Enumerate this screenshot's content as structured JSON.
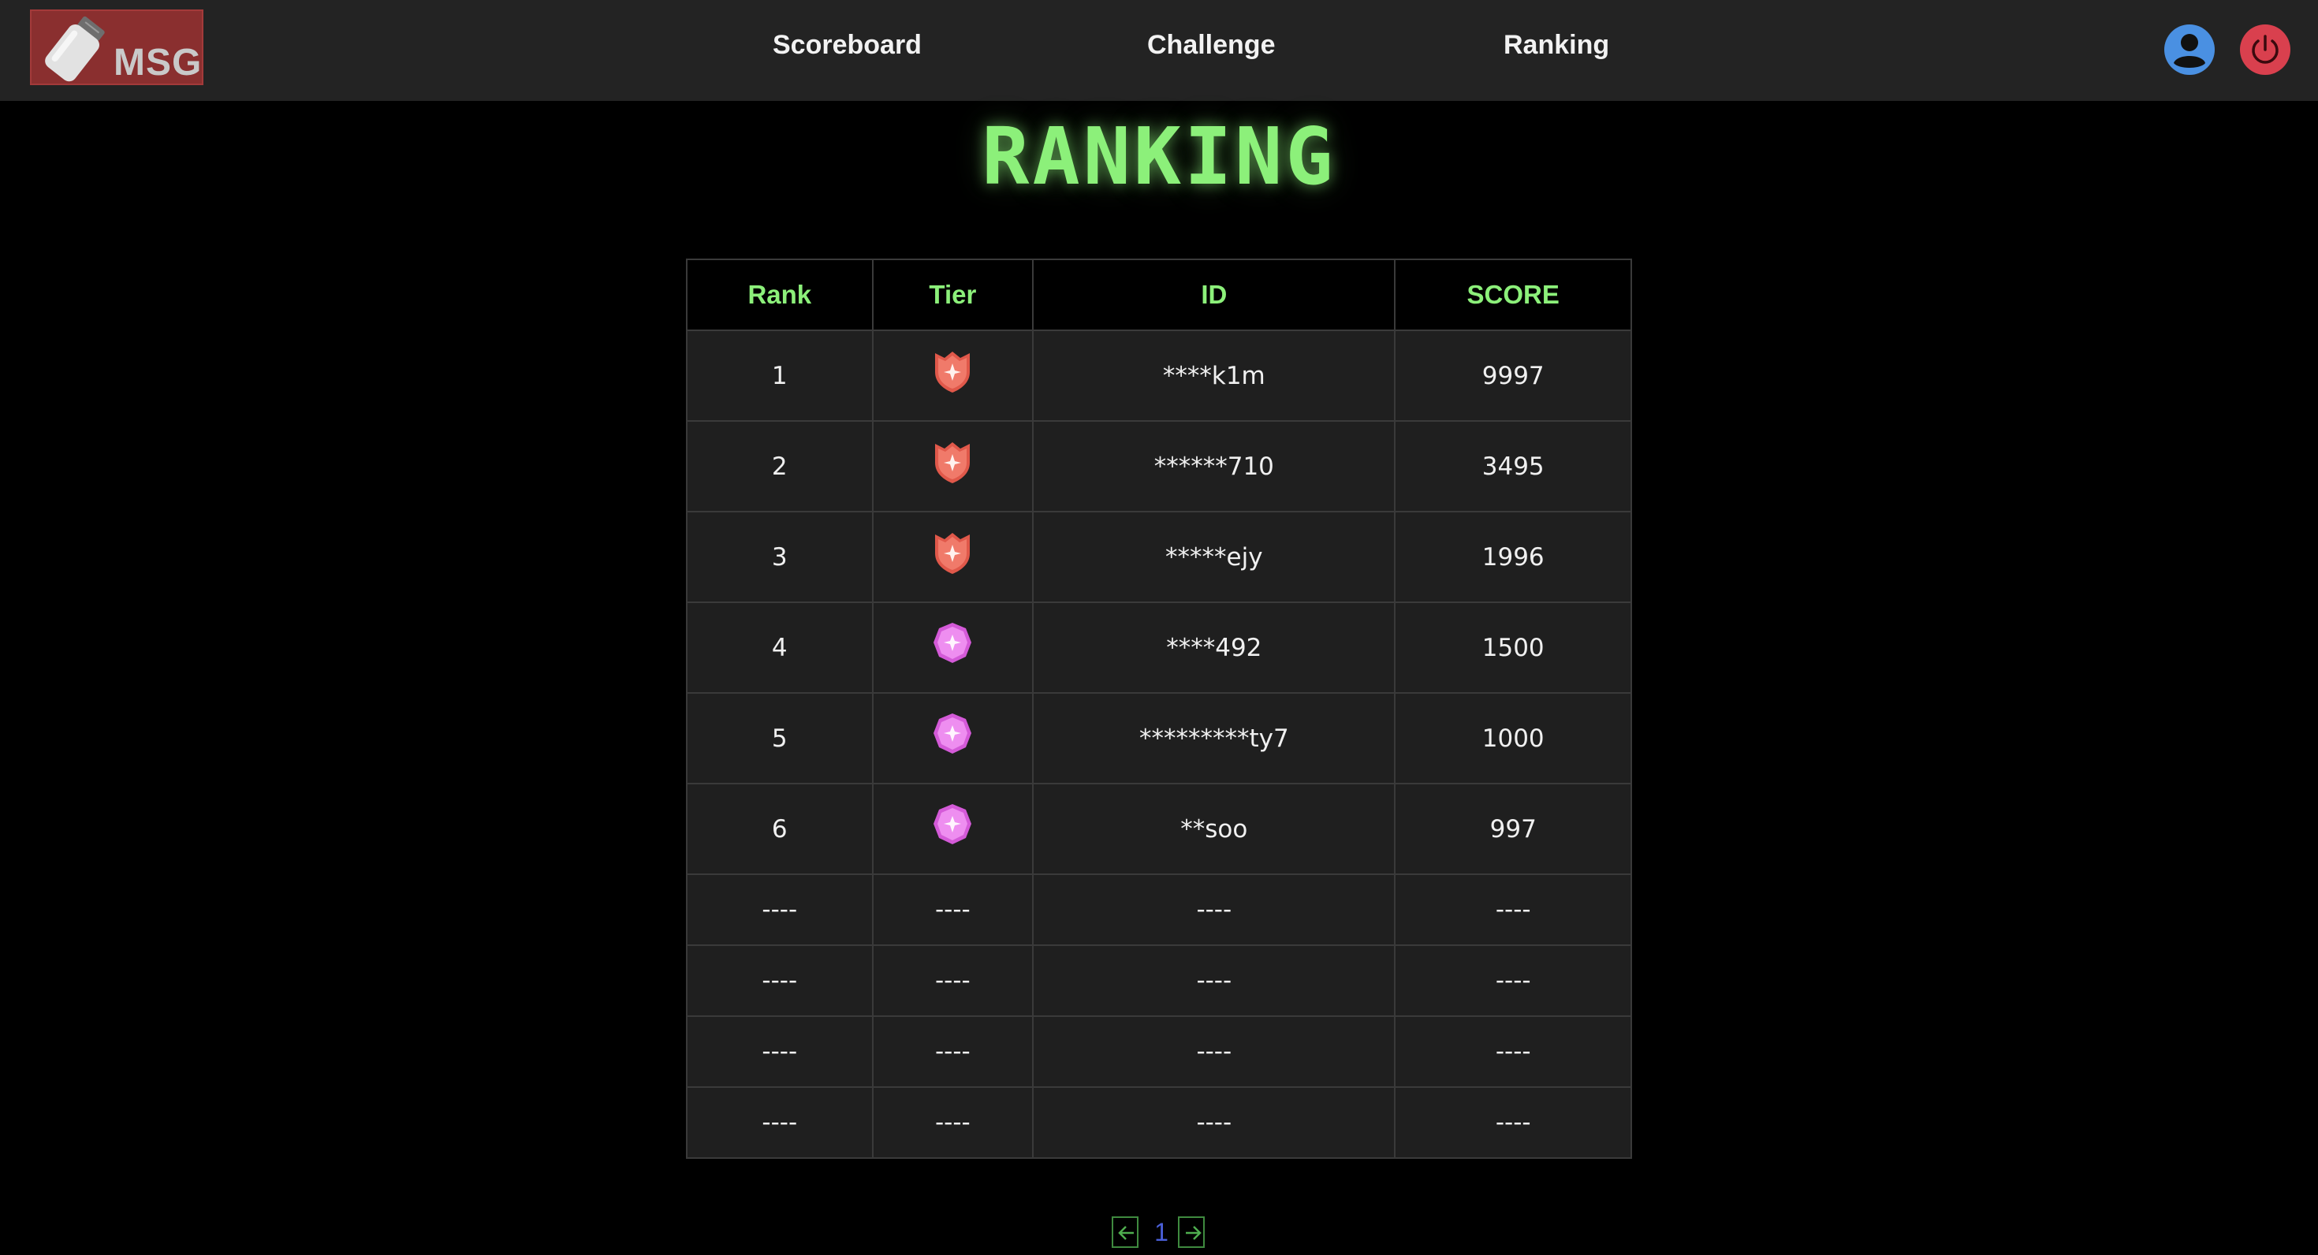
{
  "header": {
    "logo_text": "MSG",
    "nav": [
      {
        "label": "Scoreboard"
      },
      {
        "label": "Challenge"
      },
      {
        "label": "Ranking"
      }
    ],
    "user_icon": "user-circle-icon",
    "power_icon": "power-icon"
  },
  "page": {
    "title": "RANKING"
  },
  "table": {
    "headers": [
      "Rank",
      "Tier",
      "ID",
      "SCORE"
    ],
    "rows": [
      {
        "rank": "1",
        "tier": "red-shield-tier-icon",
        "id": "****k1m",
        "score": "9997"
      },
      {
        "rank": "2",
        "tier": "red-shield-tier-icon",
        "id": "******710",
        "score": "3495"
      },
      {
        "rank": "3",
        "tier": "red-shield-tier-icon",
        "id": "*****ejy",
        "score": "1996"
      },
      {
        "rank": "4",
        "tier": "pink-gem-tier-icon",
        "id": "****492",
        "score": "1500"
      },
      {
        "rank": "5",
        "tier": "pink-gem-tier-icon",
        "id": "*********ty7",
        "score": "1000"
      },
      {
        "rank": "6",
        "tier": "pink-gem-tier-icon",
        "id": "**soo",
        "score": "997"
      }
    ],
    "empty_rows": [
      {
        "rank": "----",
        "tier": "----",
        "id": "----",
        "score": "----"
      },
      {
        "rank": "----",
        "tier": "----",
        "id": "----",
        "score": "----"
      },
      {
        "rank": "----",
        "tier": "----",
        "id": "----",
        "score": "----"
      },
      {
        "rank": "----",
        "tier": "----",
        "id": "----",
        "score": "----"
      }
    ]
  },
  "pagination": {
    "current_page": "1",
    "prev_icon": "arrow-left-icon",
    "next_icon": "arrow-right-icon"
  },
  "colors": {
    "accent_green": "#8cf07a",
    "header_bg": "#232323",
    "logo_bg": "#8a2f2f",
    "user_blue": "#4a90e2",
    "power_red": "#d9404e",
    "page_blue": "#4a5fd8"
  }
}
